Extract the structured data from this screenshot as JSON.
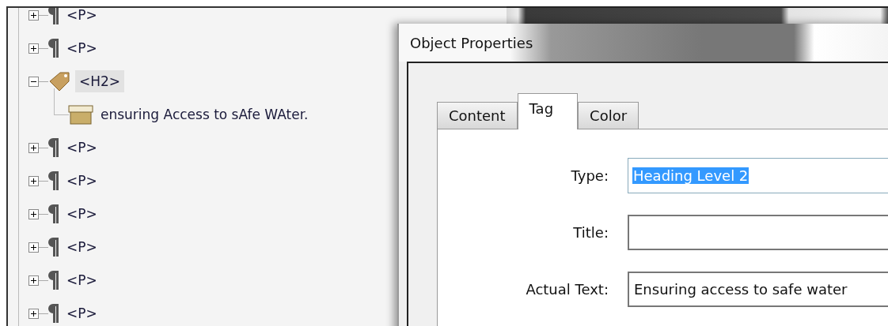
{
  "tag_tree": {
    "items": [
      {
        "kind": "paragraph",
        "label": "<P>",
        "expanded": false,
        "selected": false
      },
      {
        "kind": "paragraph",
        "label": "<P>",
        "expanded": false,
        "selected": false
      },
      {
        "kind": "tag",
        "label": "<H2>",
        "expanded": true,
        "selected": true,
        "children": [
          {
            "kind": "content",
            "label": "ensuring Access to sAfe WAter.",
            "selected": false
          }
        ]
      },
      {
        "kind": "paragraph",
        "label": "<P>",
        "expanded": false,
        "selected": false
      },
      {
        "kind": "paragraph",
        "label": "<P>",
        "expanded": false,
        "selected": false
      },
      {
        "kind": "paragraph",
        "label": "<P>",
        "expanded": false,
        "selected": false
      },
      {
        "kind": "paragraph",
        "label": "<P>",
        "expanded": false,
        "selected": false
      },
      {
        "kind": "paragraph",
        "label": "<P>",
        "expanded": false,
        "selected": false
      },
      {
        "kind": "paragraph",
        "label": "<P>",
        "expanded": false,
        "selected": false
      }
    ]
  },
  "dialog": {
    "title": "Object Properties",
    "tabs": [
      {
        "label": "Content",
        "selected": false
      },
      {
        "label": "Tag",
        "selected": true
      },
      {
        "label": "Color",
        "selected": false
      }
    ],
    "fields": [
      {
        "label": "Type:",
        "value": "Heading Level 2",
        "highlighted": true
      },
      {
        "label": "Title:",
        "highlighted": false
      },
      {
        "label": "Actual Text:",
        "value": "Ensuring access to safe water",
        "highlighted": false
      }
    ]
  }
}
